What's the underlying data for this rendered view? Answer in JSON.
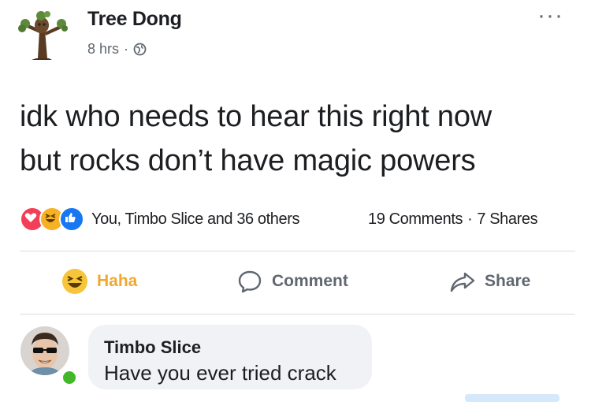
{
  "post": {
    "author": "Tree Dong",
    "time": "8 hrs",
    "meta_separator": "·",
    "privacy_icon": "globe-icon",
    "more_icon": "ellipsis-icon",
    "more_glyph": "···",
    "text_lines": [
      "idk who needs to hear this right now",
      "but rocks don’t have magic powers"
    ]
  },
  "reactions": {
    "icons": [
      "love-reaction-icon",
      "haha-reaction-icon",
      "like-reaction-icon"
    ],
    "summary": "You, Timbo Slice and 36 others",
    "comments": "19 Comments",
    "separator": "·",
    "shares": "7 Shares"
  },
  "actions": {
    "haha_label": "Haha",
    "comment_label": "Comment",
    "share_label": "Share"
  },
  "comment": {
    "author": "Timbo Slice",
    "text": "Have you ever tried crack",
    "online_color": "#42b72a"
  },
  "colors": {
    "haha_active": "#f0a830",
    "text_primary": "#1c1e21",
    "text_secondary": "#606770",
    "bubble_bg": "#f0f2f5",
    "love": "#f33e58",
    "like": "#1877f2"
  }
}
